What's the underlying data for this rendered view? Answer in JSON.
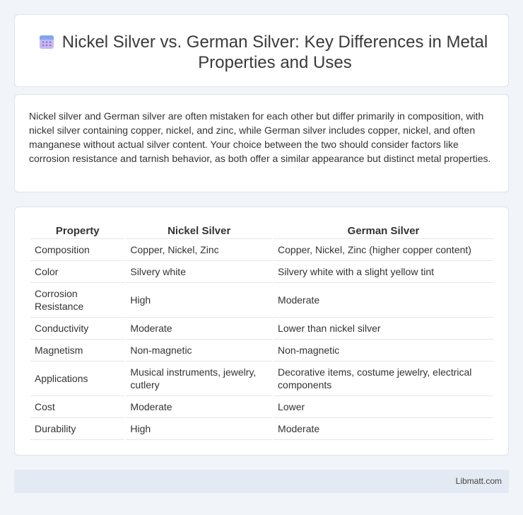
{
  "header": {
    "icon": "calendar-icon",
    "title": "Nickel Silver vs. German Silver: Key Differences in Metal Properties and Uses"
  },
  "intro": {
    "text": "Nickel silver and German silver are often mistaken for each other but differ primarily in composition, with nickel silver containing copper, nickel, and zinc, while German silver includes copper, nickel, and often manganese without actual silver content. Your choice between the two should consider factors like corrosion resistance and tarnish behavior, as both offer a similar appearance but distinct metal properties."
  },
  "table": {
    "headers": [
      "Property",
      "Nickel Silver",
      "German Silver"
    ],
    "rows": [
      [
        "Composition",
        "Copper, Nickel, Zinc",
        "Copper, Nickel, Zinc (higher copper content)"
      ],
      [
        "Color",
        "Silvery white",
        "Silvery white with a slight yellow tint"
      ],
      [
        "Corrosion Resistance",
        "High",
        "Moderate"
      ],
      [
        "Conductivity",
        "Moderate",
        "Lower than nickel silver"
      ],
      [
        "Magnetism",
        "Non-magnetic",
        "Non-magnetic"
      ],
      [
        "Applications",
        "Musical instruments, jewelry, cutlery",
        "Decorative items, costume jewelry, electrical components"
      ],
      [
        "Cost",
        "Moderate",
        "Lower"
      ],
      [
        "Durability",
        "High",
        "Moderate"
      ]
    ]
  },
  "footer": {
    "site": "Libmatt.com"
  }
}
